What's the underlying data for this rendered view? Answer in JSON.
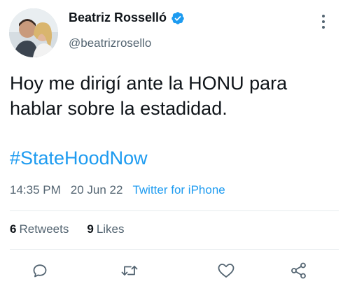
{
  "tweet": {
    "author": {
      "display_name": "Beatriz Rosselló",
      "handle": "@beatrizrosello",
      "verified": true
    },
    "text": "Hoy me dirigí ante la HONU para hablar sobre la estadidad.",
    "hashtag": "#StateHoodNow",
    "time": "14:35 PM",
    "date": "20 Jun 22",
    "source": "Twitter for iPhone",
    "stats": {
      "retweets_count": "6",
      "retweets_label": "Retweets",
      "likes_count": "9",
      "likes_label": "Likes"
    }
  },
  "icons": {
    "more": "more-vertical-icon",
    "reply": "reply-icon",
    "retweet": "retweet-icon",
    "like": "heart-icon",
    "share": "share-icon",
    "verified": "verified-badge-icon"
  },
  "colors": {
    "accent": "#1d9bf0",
    "text": "#0f1419",
    "secondary": "#536471",
    "divider": "#e7ebee"
  }
}
